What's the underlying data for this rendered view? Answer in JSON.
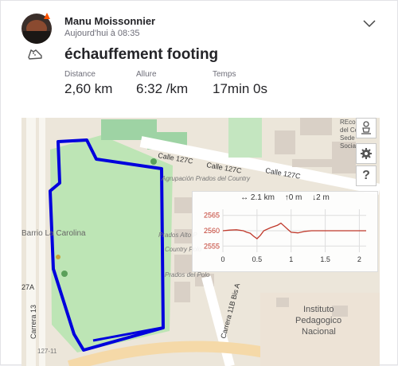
{
  "post": {
    "user_name": "Manu Moissonnier",
    "timestamp": "Aujourd'hui à 08:35",
    "activity_title": "échauffement footing",
    "activity_icon": "running-shoe-icon",
    "menu_icon": "chevron-down-icon"
  },
  "stats": [
    {
      "label": "Distance",
      "value": "2,60 km"
    },
    {
      "label": "Allure",
      "value": "6:32 /km"
    },
    {
      "label": "Temps",
      "value": "17min 0s"
    }
  ],
  "map": {
    "streets": {
      "calle_a": "Calle 127C",
      "calle_b": "Calle 127C",
      "calle_c": "Calle 127C",
      "carrera_11b": "Carrera 11B Bis A",
      "carrera_13": "Carrera 13",
      "n27a": "27A",
      "n127": "127-11"
    },
    "places": {
      "barrio": "Barrio La Carolina",
      "agrupacion": "Agrupación Prados del Country",
      "prados_alto": "Prados Alto P",
      "country_polo": "Country Polo",
      "prados_del_polo": "Prados del Polo",
      "recod_l1": "REcod",
      "recod_l2": "del Country",
      "recod_l3": "Sede",
      "recod_l4": "Socia",
      "instituto_l1": "Instituto",
      "instituto_l2": "Pedagogico",
      "instituto_l3": "Nacional"
    },
    "controls": [
      "street-view-icon",
      "settings-gear-icon",
      "help-icon"
    ],
    "help_glyph": "?",
    "route_color": "#0000dd",
    "park_color": "#bde5b5"
  },
  "elevation": {
    "distance_summary": "↔ 2.1 km",
    "gain_summary": "↑0 m",
    "loss_summary": "↓2 m",
    "line_color": "#c0392b"
  },
  "chart_data": {
    "type": "line",
    "title": "",
    "xlabel": "",
    "ylabel": "",
    "x_ticks": [
      "0",
      "0.5",
      "1",
      "1.5",
      "2"
    ],
    "y_ticks": [
      "2565",
      "2560",
      "2555"
    ],
    "xlim": [
      0,
      2.1
    ],
    "ylim": [
      2553,
      2567
    ],
    "x": [
      0,
      0.1,
      0.2,
      0.3,
      0.35,
      0.4,
      0.45,
      0.5,
      0.55,
      0.6,
      0.7,
      0.8,
      0.85,
      0.9,
      0.95,
      1.0,
      1.1,
      1.2,
      1.3,
      1.5,
      1.7,
      1.9,
      2.1
    ],
    "y": [
      2560,
      2560.2,
      2560.3,
      2560,
      2559.5,
      2559.2,
      2558.2,
      2557.4,
      2558.5,
      2560,
      2561,
      2561.8,
      2562.5,
      2561.5,
      2560.5,
      2559.5,
      2559.3,
      2559.8,
      2560,
      2560,
      2560,
      2560,
      2560
    ]
  }
}
